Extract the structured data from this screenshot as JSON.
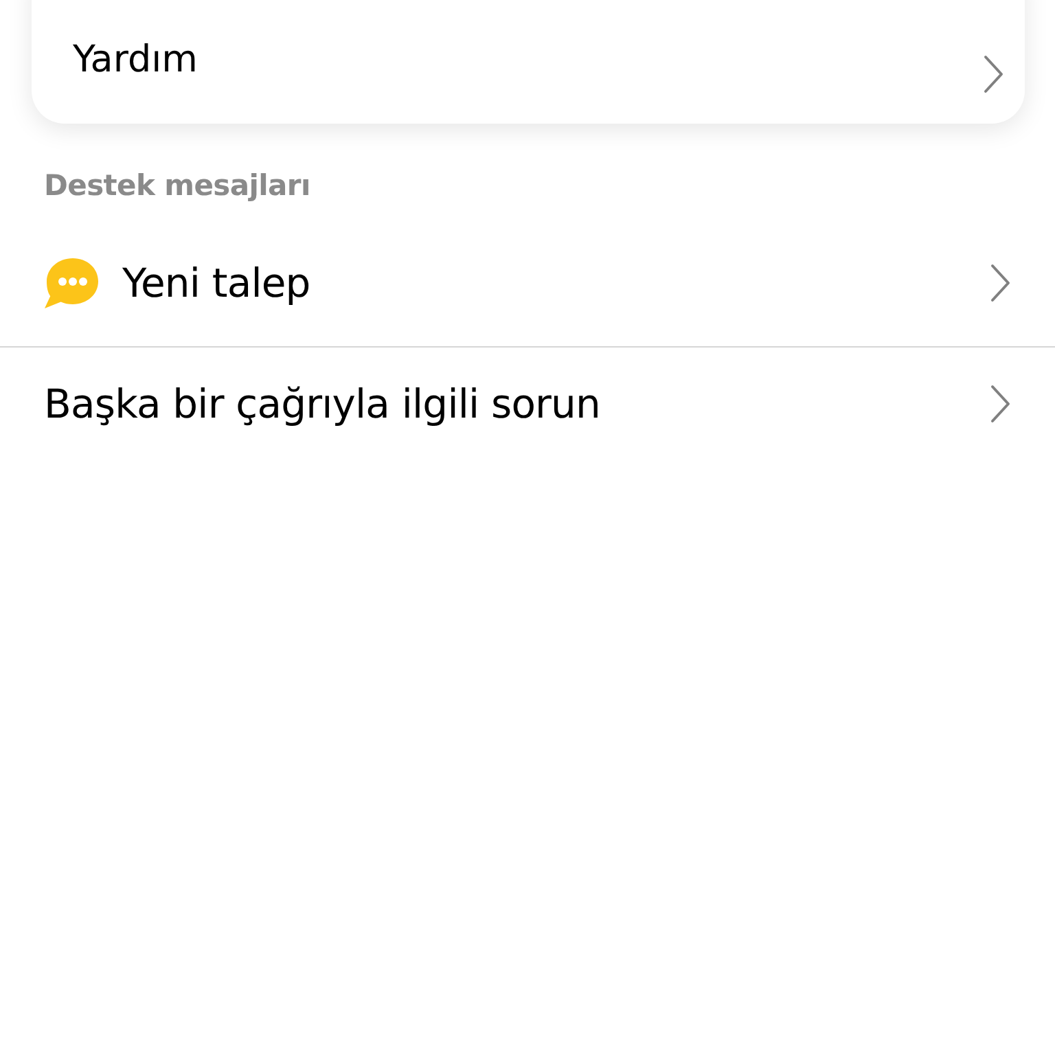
{
  "help_card": {
    "items": [
      {
        "label": "Yardım"
      }
    ]
  },
  "support_section": {
    "title": "Destek mesajları",
    "items": [
      {
        "kind": "chat",
        "label": "Yeni talep"
      },
      {
        "kind": "plain",
        "label": "Başka bir çağrıyla ilgili sorun"
      }
    ]
  }
}
